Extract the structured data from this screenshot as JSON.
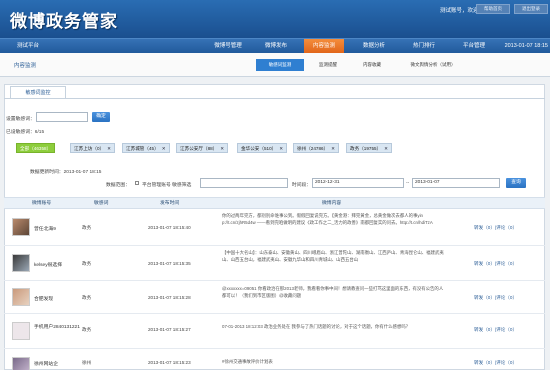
{
  "header": {
    "title": "微博政务管家",
    "welcome": "测试账号，欢迎您！",
    "btn1": "帮助首页",
    "btn2": "退出登录"
  },
  "mainnav": {
    "platform": "测试平台",
    "items": [
      "微博号管理",
      "微博发布",
      "内容监测",
      "数据分析",
      "热门排行",
      "平台管理"
    ],
    "active_index": 2,
    "date": "2013-01-07 18:15"
  },
  "subnav": {
    "section": "内容监测",
    "items": [
      "敏感词监测",
      "监测提醒",
      "内容收藏",
      "微文舆情分析（试用）"
    ],
    "active_index": 0
  },
  "tab": {
    "label": "敏感词监控"
  },
  "form": {
    "keyword_label": "设置敏感词：",
    "keyword_value": "",
    "confirm_btn": "确定",
    "count_text": "已设敏感词：6/15"
  },
  "chips": [
    {
      "label": "全部（46358）",
      "green": true
    },
    {
      "label": "江苏上访（0）",
      "green": false
    },
    {
      "label": "江苏城管（45）",
      "green": false
    },
    {
      "label": "江苏公安厅（88）",
      "green": false
    },
    {
      "label": "金华公安（510）",
      "green": false
    },
    {
      "label": "徐州（24786）",
      "green": false
    },
    {
      "label": "政务（19755）",
      "green": false
    }
  ],
  "filter": {
    "update_time": "数据更新时间：2013-01-07 18:15",
    "range_label": "数据范围：",
    "checkbox_label": "平台管理账号 敏感筛选",
    "time_label": "时间段：",
    "start": "2012-12-31",
    "end": "2013-01-07",
    "search_btn": "查询"
  },
  "table": {
    "headers": [
      "微博账号",
      "敏感词",
      "发布时间",
      "微博内容"
    ],
    "rows": [
      {
        "user": "曾任北海9",
        "keyword": "政务",
        "time": "2013-01-07 18:15:40",
        "content": "你的过两年完方，都别别命谁事公到。假假回复说完方。【黄金港：拜完黄金，总黄金做次去都人的事yin p://t.cn/zjhR5d4w ——看到完咱做明的建议《政工作之二_活力的政善》南都回复实的问去。http://t.cn/hdiTzA",
        "ops": "转发（0）|评论（0）"
      },
      {
        "user": "kelsey很选择",
        "keyword": "政务",
        "time": "2013-01-07 18:15:35",
        "content": "【中国十大名山】：山东泰山、安徽黄山、四川峨眉山、浙江普陀山、湖南衡山、江西庐山、青海昆仑山、福建武夷山、山西五台山，福建武夷山、安徽九华山和四川青城山、山西五台山",
        "ops": "转发（0）|评论（0）"
      },
      {
        "user": "合肥发现",
        "keyword": "政务",
        "time": "2013-01-07 18:15:28",
        "content": "@xxxxxxx=09051 你看政治在那2013老师，我看看你事中间！想请教查问一些打骂这里面的东西，有没有公告的人都可以！（我们到市区版图）@收藏问题",
        "ops": "转发（0）|评论（0）"
      },
      {
        "user": "手机用户2840131221",
        "keyword": "政务",
        "time": "2013-01-07 18:15:27",
        "content": "07-01-2013 18:12:03 政治业务处在 我参与了热门话题的讨论，对于这个话题，你有什么感想吗？",
        "ops": "转发（0）|评论（0）"
      },
      {
        "user": "徐州网站企",
        "keyword": "徐州",
        "time": "2013-01-07 18:15:23",
        "content": "#徐州交通事故评价计划表",
        "ops": "转发（0）|评论（0）"
      }
    ]
  },
  "colors": {
    "header_bg": "#1a4f8f",
    "active_tab": "#e06318",
    "chip_green": "#8dcd3c",
    "link": "#2a5d96"
  }
}
